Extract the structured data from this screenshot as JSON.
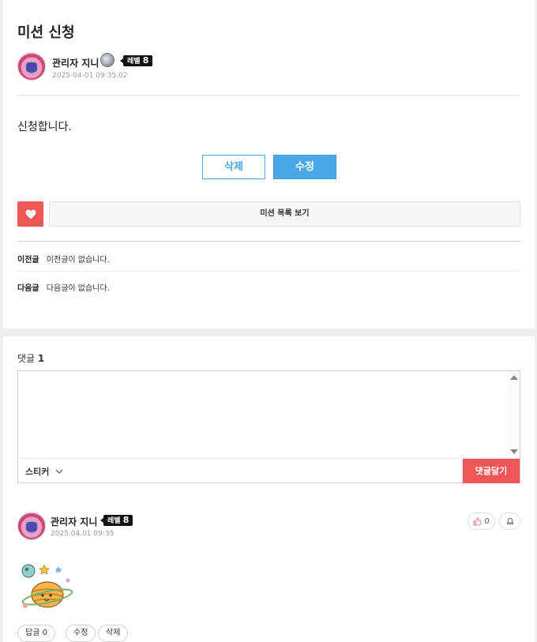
{
  "post": {
    "title": "미션 신청",
    "author": {
      "name": "관리자 지니",
      "level_prefix": "레벨",
      "level": "8",
      "date": "2025-04-01 09:35:02"
    },
    "content": "신청합니다.",
    "delete_label": "삭제",
    "edit_label": "수정",
    "list_label": "미션 목록 보기",
    "prev": {
      "label": "이전글",
      "text": "이전글이 없습니다."
    },
    "next": {
      "label": "다음글",
      "text": "다음글이 없습니다."
    }
  },
  "comments": {
    "header_label": "댓글",
    "count": "1",
    "editor": {
      "placeholder": "",
      "sticker_label": "스티커",
      "submit_label": "댓글달기"
    },
    "items": [
      {
        "author": "관리자 지니",
        "level_prefix": "레벨",
        "level": "8",
        "date": "2025.04.01 09:35",
        "likes": "0",
        "reply_label": "답글",
        "reply_count": "0",
        "edit_label": "수정",
        "delete_label": "삭제"
      }
    ]
  },
  "colors": {
    "accent_blue": "#4aa8e8",
    "accent_red": "#f05656"
  }
}
